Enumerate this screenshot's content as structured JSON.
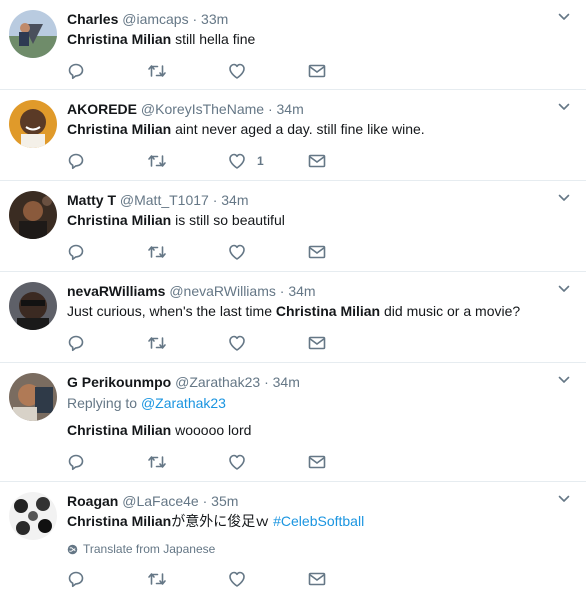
{
  "tweets": [
    {
      "name": "Charles",
      "handle": "@iamcaps",
      "sep": "·",
      "time": "33m",
      "text_bold": "Christina Milian",
      "text_rest": " still hella fine",
      "like_count": ""
    },
    {
      "name": "AKOREDE",
      "handle": "@KoreyIsTheName",
      "sep": "·",
      "time": "34m",
      "text_bold": "Christina Milian",
      "text_rest": " aint never aged a day. still fine like wine.",
      "like_count": "1"
    },
    {
      "name": "Matty T",
      "handle": "@Matt_T1017",
      "sep": "·",
      "time": "34m",
      "text_bold": "Christina Milian",
      "text_rest": " is still so beautiful",
      "like_count": ""
    },
    {
      "name": "nevaRWilliams",
      "handle": "@nevaRWilliams",
      "sep": "·",
      "time": "34m",
      "text_pre": "Just curious, when's the last time ",
      "text_bold": "Christina Milian",
      "text_rest": " did music or a movie?",
      "like_count": ""
    },
    {
      "name": "G Perikounmpo",
      "handle": "@Zarathak23",
      "sep": "·",
      "time": "34m",
      "replying_label": "Replying to ",
      "replying_handle": "@Zarathak23",
      "text_bold": "Christina Milian",
      "text_rest": " wooooo lord",
      "like_count": ""
    },
    {
      "name": "Roagan",
      "handle": "@LaFace4e",
      "sep": "·",
      "time": "35m",
      "text_bold": "Christina Milian",
      "text_rest": "が意外に俊足ｗ ",
      "hashtag": "#CelebSoftball",
      "translate_label": "Translate from Japanese",
      "like_count": ""
    }
  ],
  "icons": {
    "reply": "reply-icon",
    "retweet": "retweet-icon",
    "like": "heart-icon",
    "dm": "envelope-icon",
    "caret": "chevron-down-icon",
    "globe": "globe-icon"
  },
  "colors": {
    "text": "#14171a",
    "muted": "#657786",
    "link": "#1b95e0",
    "divider": "#e6ecf0"
  }
}
